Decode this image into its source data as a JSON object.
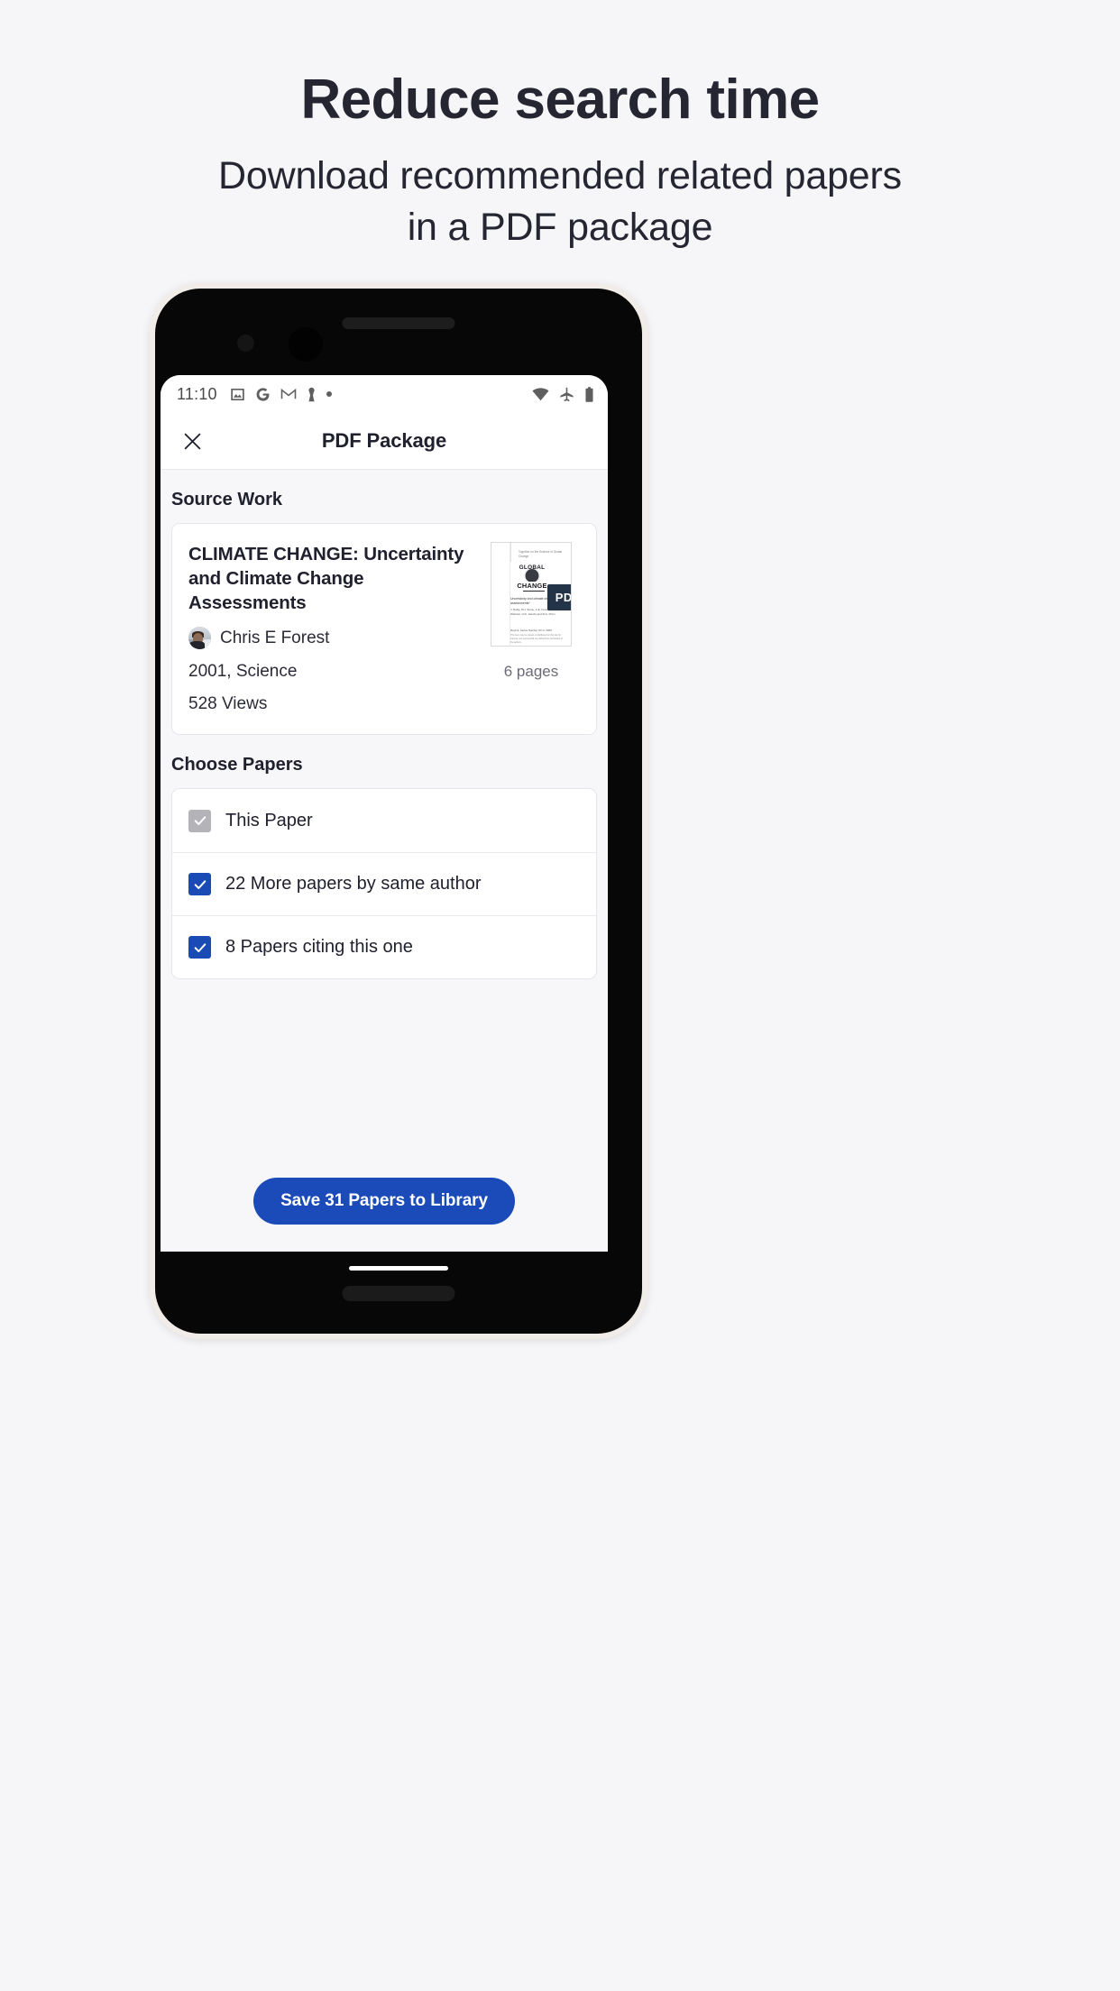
{
  "promo": {
    "title": "Reduce search time",
    "subtitle": "Download recommended related papers in a PDF package"
  },
  "status_bar": {
    "time": "11:10",
    "left_icons": [
      "image-icon",
      "google-icon",
      "gmail-icon",
      "chess-pawn-icon",
      "dot-icon"
    ],
    "right_icons": [
      "wifi-icon",
      "airplane-mode-icon",
      "battery-icon"
    ]
  },
  "app_bar": {
    "close_label": "✕",
    "title": "PDF Package"
  },
  "source_work": {
    "section_title": "Source Work",
    "paper_title": "CLIMATE CHANGE: Uncertainty and Climate Change Assessments",
    "author": "Chris E Forest",
    "year_venue": "2001, Science",
    "views": "528 Views",
    "pages": "6 pages",
    "pdf_badge": "PDF",
    "thumbnail": {
      "header": "Together on the Science of Global Change",
      "logo_top": "GLOBAL",
      "logo_bottom": "CHANGE",
      "title": "Uncertainty and climate change assessments*",
      "authors": "J. Reilly, P.H. Stone, C.E. Forest, M.D. Webster, H.D. Jacoby and R.G. Prinn",
      "report": "Reprint, Series Number XX-X, 200X",
      "disclaimer": "This item may be copied or distributed on this site for internal, non-commercial use without the permission of the authors."
    }
  },
  "choose_papers": {
    "section_title": "Choose Papers",
    "options": [
      {
        "label": "This Paper",
        "checked": true,
        "state": "disabled"
      },
      {
        "label": "22 More papers by same author",
        "checked": true,
        "state": "enabled"
      },
      {
        "label": "8 Papers citing this one",
        "checked": true,
        "state": "enabled"
      }
    ]
  },
  "cta": {
    "label": "Save 31 Papers to Library"
  },
  "colors": {
    "page_background": "#f6f6f8",
    "accent_blue": "#1b4bb8",
    "checkbox_blue": "#1a4bb5",
    "checkbox_gray": "#b3b3b8",
    "pdf_badge": "#233449",
    "text_dark": "#20202e",
    "text_muted": "#6b6b77",
    "device_frame": "#f1ece8"
  }
}
